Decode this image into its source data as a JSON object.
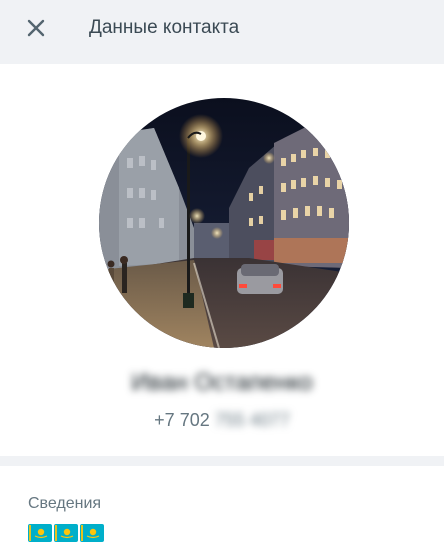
{
  "header": {
    "title": "Данные контакта",
    "close_icon": "close-icon"
  },
  "profile": {
    "name": "Иван Остапенко",
    "phone_visible": "+7 702",
    "phone_hidden": "755 4077"
  },
  "about": {
    "label": "Сведения",
    "flags": [
      "flag-kz",
      "flag-kz",
      "flag-kz"
    ]
  },
  "colors": {
    "header_bg": "#f0f2f5",
    "title_text": "#3b4a54",
    "secondary_text": "#667781",
    "card_bg": "#ffffff",
    "flag_blue": "#00afca",
    "flag_yellow": "#fec50c"
  }
}
